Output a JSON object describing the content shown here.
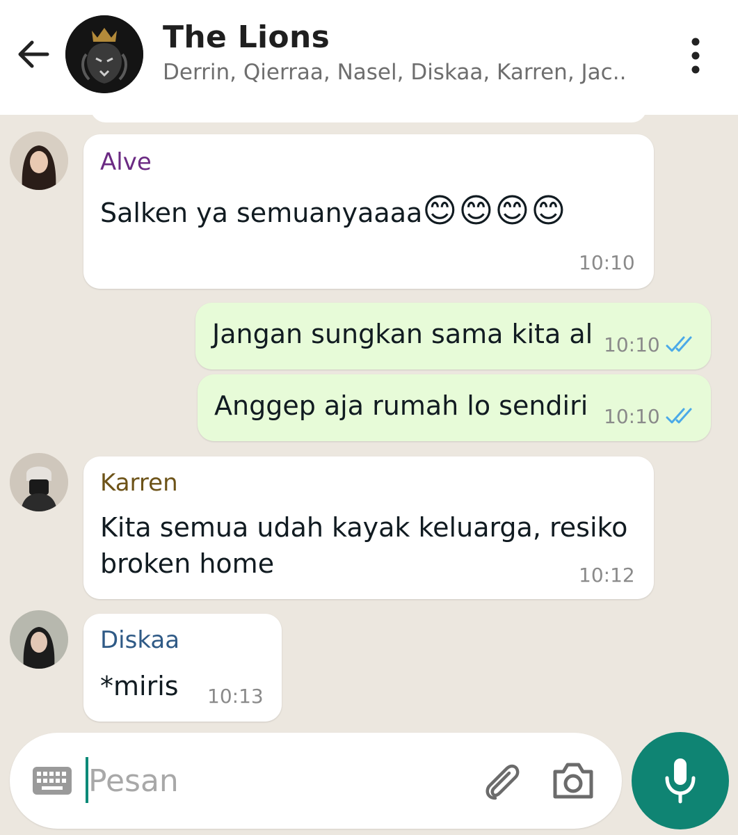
{
  "header": {
    "title": "The Lions",
    "members": "Derrin, Qierraa, Nasel, Diskaa, Karren, Jac.."
  },
  "messages": [
    {
      "type": "incoming",
      "sender": "Alve",
      "sender_color": "#6b2a83",
      "text": "Salken ya semuanyaaaa",
      "emoji": "😊😊😊😊",
      "time": "10:10"
    },
    {
      "type": "outgoing",
      "text": "Jangan sungkan sama kita al",
      "time": "10:10",
      "status": "read"
    },
    {
      "type": "outgoing",
      "text": "Anggep aja rumah lo sendiri",
      "time": "10:10",
      "status": "read"
    },
    {
      "type": "incoming",
      "sender": "Karren",
      "sender_color": "#6d5318",
      "text_line1": "Kita semua udah kayak keluarga, resiko",
      "text_line2": "broken home",
      "time": "10:12"
    },
    {
      "type": "incoming",
      "sender": "Diskaa",
      "sender_color": "#2f5a86",
      "text": "*miris",
      "time": "10:13"
    }
  ],
  "input": {
    "placeholder": "Pesan"
  },
  "colors": {
    "accent": "#0f8473",
    "outgoing_bubble": "#e7fbd8",
    "read_ticks": "#4aa9e8"
  },
  "icons": [
    "back-arrow-icon",
    "more-vert-icon",
    "keyboard-icon",
    "paperclip-icon",
    "camera-icon",
    "mic-icon",
    "double-check-icon"
  ]
}
